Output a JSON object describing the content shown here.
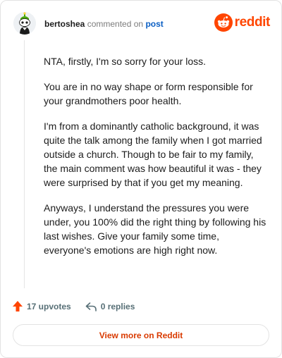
{
  "comment": {
    "username": "bertoshea",
    "action_text": "commented on",
    "link_text": "post",
    "paragraphs": [
      "NTA, firstly, I'm so sorry for your loss.",
      "You are in no way shape or form responsible for your grandmothers poor health.",
      "I'm from a dominantly catholic background, it was quite the talk among the family when I got married outside a church. Though to be fair to my family, the main comment was how beautiful it was - they were surprised by that if you get my meaning.",
      "Anyways, I understand the pressures you were under, you 100% did the right thing by following his last wishes. Give your family some time, everyone's emotions are high right now."
    ]
  },
  "brand": {
    "name": "reddit",
    "color": "#ff4500",
    "icon": "reddit-snoo-icon"
  },
  "actions": {
    "upvotes_label": "17 upvotes",
    "replies_label": "0 replies"
  },
  "footer": {
    "view_more_label": "View more on Reddit"
  }
}
